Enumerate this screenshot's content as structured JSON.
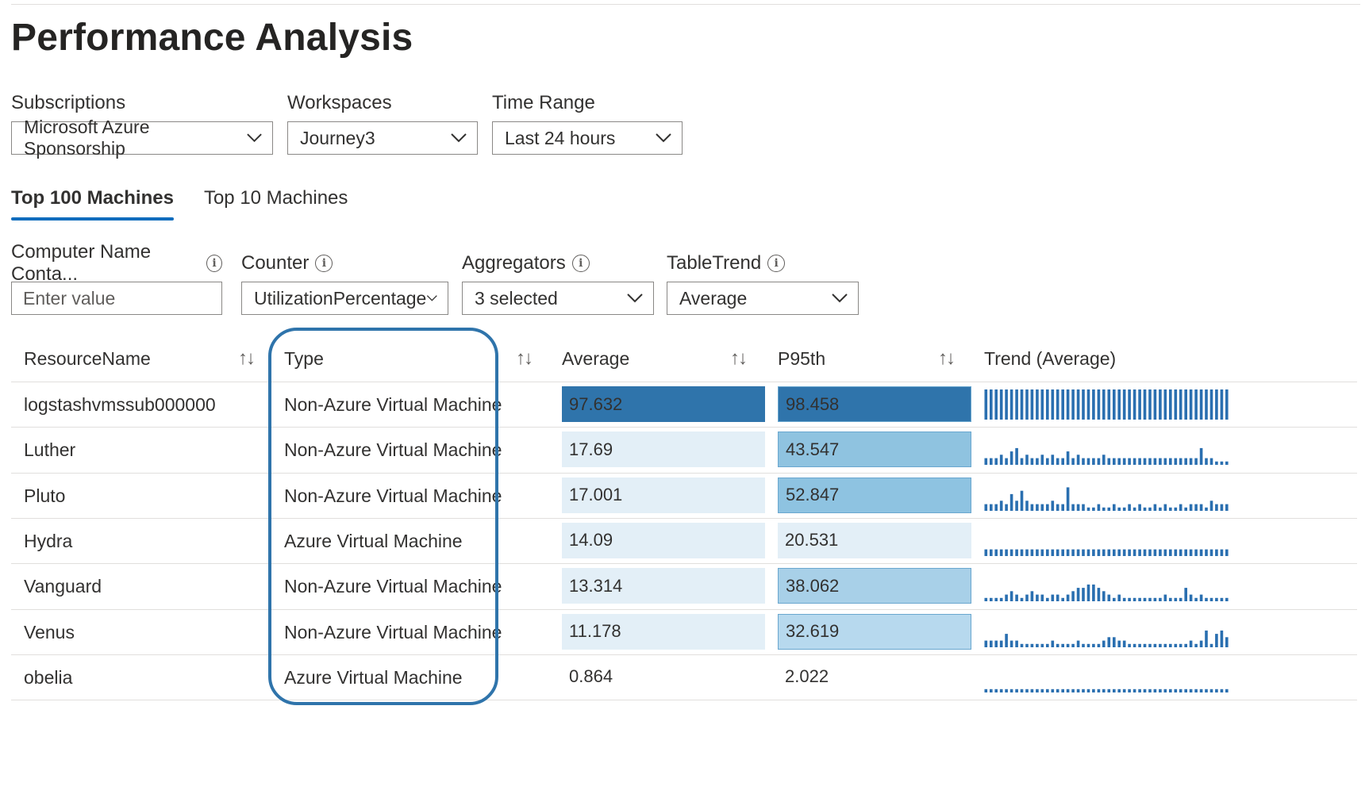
{
  "title": "Performance Analysis",
  "params": {
    "subscriptions": {
      "label": "Subscriptions",
      "value": "Microsoft Azure Sponsorship"
    },
    "workspaces": {
      "label": "Workspaces",
      "value": "Journey3"
    },
    "time_range": {
      "label": "Time Range",
      "value": "Last 24 hours"
    }
  },
  "tabs": [
    {
      "label": "Top 100 Machines",
      "active": true
    },
    {
      "label": "Top 10 Machines",
      "active": false
    }
  ],
  "filters": {
    "computer_name": {
      "label": "Computer Name Conta...",
      "placeholder": "Enter value"
    },
    "counter": {
      "label": "Counter",
      "value": "UtilizationPercentage"
    },
    "aggregators": {
      "label": "Aggregators",
      "value": "3 selected"
    },
    "table_trend": {
      "label": "TableTrend",
      "value": "Average"
    }
  },
  "icons": {
    "info": "info-icon",
    "chevron": "chevron-down-icon",
    "sort": "sort-icon"
  },
  "colors": {
    "accent": "#0f6cbd",
    "highlight_border": "#2f74ab",
    "bar_high": "#2f74ab",
    "bar_mid": "#8fc3e0",
    "bar_low": "#dcebf5",
    "trend": "#2a6fb0"
  },
  "table": {
    "columns": {
      "resource": "ResourceName",
      "type": "Type",
      "average": "Average",
      "p95": "P95th",
      "trend": "Trend (Average)"
    },
    "sort_glyph": "↑↓",
    "rows": [
      {
        "name": "logstashvmssub000000",
        "type": "Non-Azure Virtual Machine",
        "average": "97.632",
        "p95": "98.458",
        "avg_color": "#2f74ab",
        "p95_color": "#2f74ab",
        "trend": [
          9,
          9,
          9,
          9,
          9,
          9,
          9,
          9,
          9,
          9,
          9,
          9,
          9,
          9,
          9,
          9,
          9,
          9,
          9,
          9,
          9,
          9,
          9,
          9,
          9,
          9,
          9,
          9,
          9,
          9,
          9,
          9,
          9,
          9,
          9,
          9,
          9,
          9,
          9,
          9,
          9,
          9,
          9,
          9,
          9,
          9,
          9,
          9
        ]
      },
      {
        "name": "Luther",
        "type": "Non-Azure Virtual Machine",
        "average": "17.69",
        "p95": "43.547",
        "avg_color": "#e3eff7",
        "p95_color": "#8fc3e0",
        "trend": [
          2,
          2,
          2,
          3,
          2,
          4,
          5,
          2,
          3,
          2,
          2,
          3,
          2,
          3,
          2,
          2,
          4,
          2,
          3,
          2,
          2,
          2,
          2,
          3,
          2,
          2,
          2,
          2,
          2,
          2,
          2,
          2,
          2,
          2,
          2,
          2,
          2,
          2,
          2,
          2,
          2,
          2,
          5,
          2,
          2,
          1,
          1,
          1
        ]
      },
      {
        "name": "Pluto",
        "type": "Non-Azure Virtual Machine",
        "average": "17.001",
        "p95": "52.847",
        "avg_color": "#e3eff7",
        "p95_color": "#8ec3e1",
        "trend": [
          2,
          2,
          2,
          3,
          2,
          5,
          3,
          6,
          3,
          2,
          2,
          2,
          2,
          3,
          2,
          2,
          7,
          2,
          2,
          2,
          1,
          1,
          2,
          1,
          1,
          2,
          1,
          1,
          2,
          1,
          2,
          1,
          1,
          2,
          1,
          2,
          1,
          1,
          2,
          1,
          2,
          2,
          2,
          1,
          3,
          2,
          2,
          2
        ]
      },
      {
        "name": "Hydra",
        "type": "Azure Virtual Machine",
        "average": "14.09",
        "p95": "20.531",
        "avg_color": "#e3eff7",
        "p95_color": "#e3eff7",
        "trend": [
          2,
          2,
          2,
          2,
          2,
          2,
          2,
          2,
          2,
          2,
          2,
          2,
          2,
          2,
          2,
          2,
          2,
          2,
          2,
          2,
          2,
          2,
          2,
          2,
          2,
          2,
          2,
          2,
          2,
          2,
          2,
          2,
          2,
          2,
          2,
          2,
          2,
          2,
          2,
          2,
          2,
          2,
          2,
          2,
          2,
          2,
          2,
          2
        ]
      },
      {
        "name": "Vanguard",
        "type": "Non-Azure Virtual Machine",
        "average": "13.314",
        "p95": "38.062",
        "avg_color": "#e3eff7",
        "p95_color": "#a8d0e8",
        "trend": [
          1,
          1,
          1,
          1,
          2,
          3,
          2,
          1,
          2,
          3,
          2,
          2,
          1,
          2,
          2,
          1,
          2,
          3,
          4,
          4,
          5,
          5,
          4,
          3,
          2,
          1,
          2,
          1,
          1,
          1,
          1,
          1,
          1,
          1,
          1,
          2,
          1,
          1,
          1,
          4,
          2,
          1,
          2,
          1,
          1,
          1,
          1,
          1
        ]
      },
      {
        "name": "Venus",
        "type": "Non-Azure Virtual Machine",
        "average": "11.178",
        "p95": "32.619",
        "avg_color": "#e3eff7",
        "p95_color": "#b7d9ee",
        "trend": [
          2,
          2,
          2,
          2,
          4,
          2,
          2,
          1,
          1,
          1,
          1,
          1,
          1,
          2,
          1,
          1,
          1,
          1,
          2,
          1,
          1,
          1,
          1,
          2,
          3,
          3,
          2,
          2,
          1,
          1,
          1,
          1,
          1,
          1,
          1,
          1,
          1,
          1,
          1,
          1,
          2,
          1,
          2,
          5,
          1,
          4,
          5,
          3
        ]
      },
      {
        "name": "obelia",
        "type": "Azure Virtual Machine",
        "average": "0.864",
        "p95": "2.022",
        "avg_color": "#ffffff",
        "p95_color": "#ffffff",
        "trend": [
          1,
          1,
          1,
          1,
          1,
          1,
          1,
          1,
          1,
          1,
          1,
          1,
          1,
          1,
          1,
          1,
          1,
          1,
          1,
          1,
          1,
          1,
          1,
          1,
          1,
          1,
          1,
          1,
          1,
          1,
          1,
          1,
          1,
          1,
          1,
          1,
          1,
          1,
          1,
          1,
          1,
          1,
          1,
          1,
          1,
          1,
          1,
          1
        ]
      }
    ]
  }
}
